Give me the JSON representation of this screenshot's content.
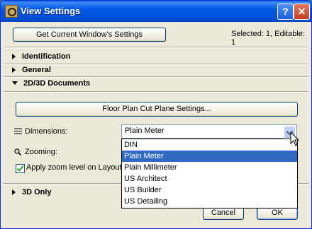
{
  "window": {
    "title": "View Settings",
    "help_label": "?",
    "close_label": "✕"
  },
  "toolbar": {
    "get_current_label": "Get Current Window's Settings",
    "selection_status": "Selected: 1, Editable: 1"
  },
  "sections": {
    "identification": "Identification",
    "general": "General",
    "docs": "2D/3D Documents",
    "only3d": "3D Only"
  },
  "docs": {
    "floor_plan_button": "Floor Plan Cut Plane Settings...",
    "dimensions_label": "Dimensions:",
    "dimensions_value": "Plain Meter",
    "zooming_label": "Zooming:",
    "apply_zoom_label": "Apply zoom level on Layouts",
    "apply_zoom_checked": true
  },
  "dimensions_options": [
    "DIN",
    "Plain Meter",
    "Plain Millimeter",
    "US Architect",
    "US Builder",
    "US Detailing"
  ],
  "dimensions_selected_index": 1,
  "footer": {
    "cancel_label": "Cancel",
    "ok_label": "OK"
  },
  "icons": {
    "app": "archicad-app-icon",
    "dimensions": "dimension-icon",
    "zoom": "magnifier-icon",
    "cursor": "mouse-pointer-icon"
  },
  "colors": {
    "titlebar": "#0058e6",
    "selection": "#316ac5",
    "dialog_bg": "#ece9d8"
  }
}
